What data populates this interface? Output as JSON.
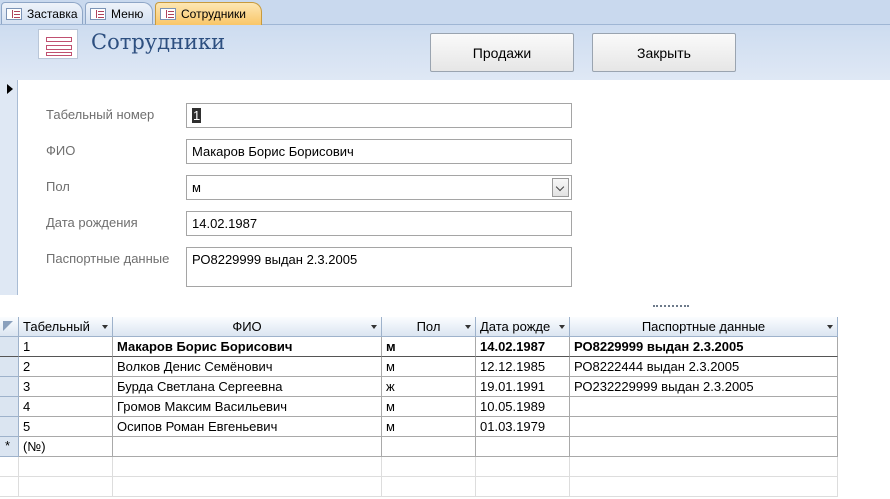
{
  "tabs": [
    {
      "label": "Заставка",
      "active": false
    },
    {
      "label": "Меню",
      "active": false
    },
    {
      "label": "Сотрудники",
      "active": true
    }
  ],
  "header": {
    "title": "Сотрудники",
    "buttons": {
      "sales": "Продажи",
      "close": "Закрыть"
    }
  },
  "form": {
    "fields": [
      {
        "label": "Табельный номер",
        "value": "1"
      },
      {
        "label": "ФИО",
        "value": "Макаров Борис Борисович"
      },
      {
        "label": "Пол",
        "value": "м"
      },
      {
        "label": "Дата рождения",
        "value": "14.02.1987"
      },
      {
        "label": "Паспортные данные",
        "value": "РО8229999 выдан 2.3.2005"
      }
    ]
  },
  "table": {
    "columns": [
      "Табельный",
      "ФИО",
      "Пол",
      "Дата рожде",
      "Паспортные данные"
    ],
    "rows": [
      [
        "1",
        "Макаров Борис Борисович",
        "м",
        "14.02.1987",
        "РО8229999 выдан 2.3.2005"
      ],
      [
        "2",
        "Волков Денис Семёнович",
        "м",
        "12.12.1985",
        "РО8222444 выдан 2.3.2005"
      ],
      [
        "3",
        "Бурда Светлана Сергеевна",
        "ж",
        "19.01.1991",
        "РО232229999 выдан 2.3.2005"
      ],
      [
        "4",
        "Громов Максим Васильевич",
        "м",
        "10.05.1989",
        ""
      ],
      [
        "5",
        "Осипов Роман Евгеньевич",
        "м",
        "01.03.1979",
        ""
      ]
    ],
    "new_row_marker": "*",
    "new_row_placeholder": "(№)"
  },
  "colors": {
    "active_tab": "#f9c668",
    "header_bg": "#cddcf0",
    "title": "#2d4f80"
  }
}
